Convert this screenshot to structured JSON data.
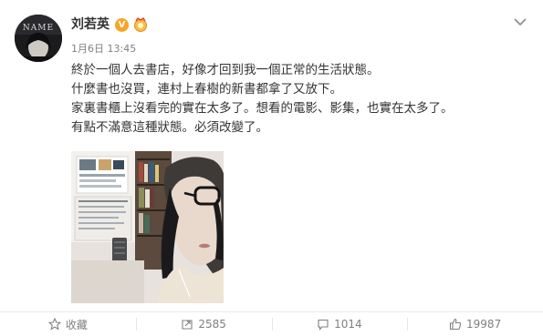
{
  "user": {
    "name": "刘若英",
    "timestamp": "1月6日 13:45",
    "verified_badge": "V",
    "avatar_text": "NAME"
  },
  "post": {
    "lines": [
      "終於一個人去書店，好像才回到我一個正常的生活狀態。",
      "什麼書也沒買，連村上春樹的新書都拿了又放下。",
      "家裏書櫃上沒看完的實在太多了。想看的電影、影集，也實在太多了。",
      "有點不滿意這種狀態。必須改變了。"
    ],
    "image_alt": "selfie-in-bookstore"
  },
  "actions": {
    "favorite_label": "收藏",
    "repost_count": "2585",
    "comment_count": "1014",
    "like_count": "19987"
  },
  "icons": {
    "more": "chevron-down-icon",
    "favorite": "star-icon",
    "repost": "repost-icon",
    "comment": "comment-icon",
    "like": "thumbs-up-icon"
  },
  "colors": {
    "verified": "#f5a623",
    "meta_text": "#808080",
    "body_text": "#333333"
  }
}
